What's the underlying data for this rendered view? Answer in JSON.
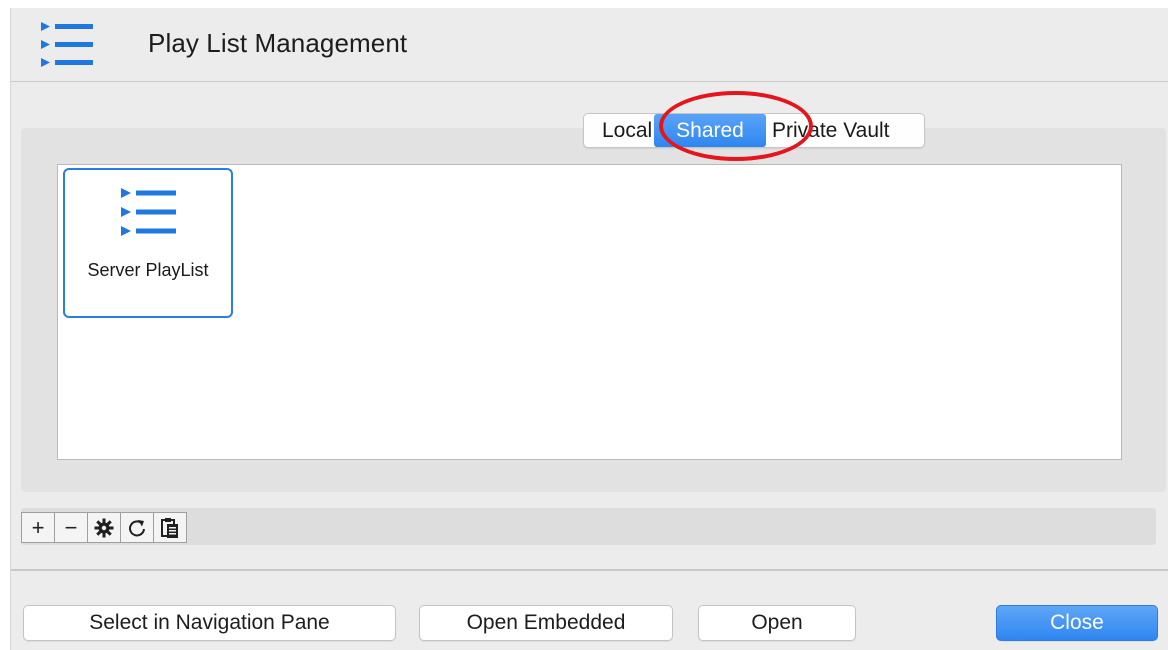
{
  "window": {
    "title": "Play List Management",
    "app_icon": "playlist-icon"
  },
  "tabs": [
    {
      "label": "Local",
      "selected": false
    },
    {
      "label": "Shared",
      "selected": true
    },
    {
      "label": "Private Vault",
      "selected": false
    }
  ],
  "annotation": {
    "highlight_color": "#e4161c",
    "target": "Shared"
  },
  "items": [
    {
      "label": "Server PlayList",
      "icon": "playlist-icon",
      "selected": true
    }
  ],
  "toolbar": {
    "buttons": [
      {
        "icon": "plus-icon",
        "glyph": "+"
      },
      {
        "icon": "minus-icon",
        "glyph": "−"
      },
      {
        "icon": "gear-icon",
        "glyph": "✱"
      },
      {
        "icon": "refresh-icon",
        "glyph": "↻"
      },
      {
        "icon": "clipboard-icon",
        "glyph": "📋"
      }
    ]
  },
  "footer": {
    "select_label": "Select in Navigation Pane",
    "embedded_label": "Open Embedded",
    "open_label": "Open",
    "close_label": "Close"
  },
  "colors": {
    "accent": "#2f86f0",
    "icon_blue": "#1f77e0",
    "background": "#ececec"
  }
}
